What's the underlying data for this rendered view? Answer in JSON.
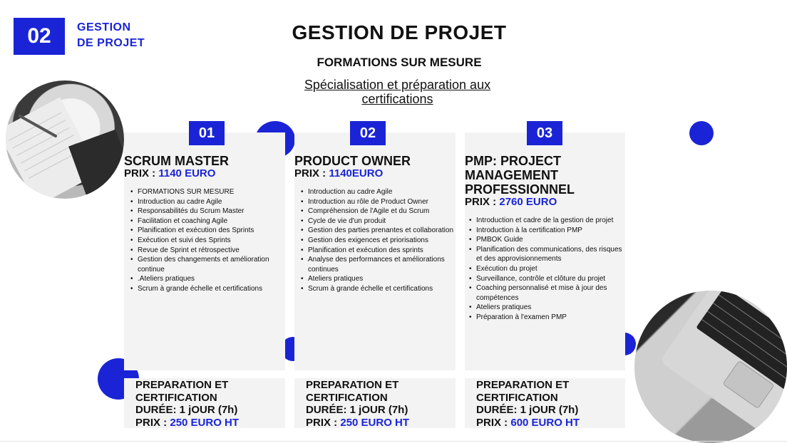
{
  "header": {
    "badge": "02",
    "section_line1": "GESTION",
    "section_line2": "DE PROJET",
    "title": "GESTION DE PROJET",
    "subtitle": "FORMATIONS SUR MESURE",
    "specialisation": "Spécialisation et préparation aux certifications"
  },
  "colors": {
    "accent": "#1a24d6",
    "card_bg": "#f3f3f3"
  },
  "cards": [
    {
      "number": "01",
      "title": "SCRUM MASTER",
      "price_label": "PRIX :",
      "price": "1140 EURO",
      "topics": [
        "FORMATIONS SUR MESURE",
        "Introduction au cadre Agile",
        "Responsabilités du Scrum Master",
        "Facilitation et coaching Agile",
        "Planification et exécution des Sprints",
        "Exécution et suivi des Sprints",
        "Revue de Sprint et rétrospective",
        "Gestion des changements et amélioration continue",
        ".Ateliers pratiques",
        "Scrum à grande échelle et certifications"
      ],
      "prep_title": "PREPARATION ET CERTIFICATION",
      "prep_duration": "DURÉE: 1 jOUR (7h)",
      "prep_price_label": "PRIX :",
      "prep_price": "250 EURO HT"
    },
    {
      "number": "02",
      "title": "PRODUCT OWNER",
      "price_label": "PRIX :",
      "price": "1140EURO",
      "topics": [
        "Introduction au cadre Agile",
        "Introduction au rôle de Product Owner",
        "Compréhension de l'Agile et du Scrum",
        "Cycle de vie d'un produit",
        "Gestion des parties prenantes et collaboration",
        "Gestion des exigences et priorisations",
        "Planification et exécution des sprints",
        "Analyse des performances et améliorations continues",
        "Ateliers pratiques",
        "Scrum à grande échelle et certifications"
      ],
      "prep_title": "PREPARATION ET CERTIFICATION",
      "prep_duration": "DURÉE: 1 jOUR (7h)",
      "prep_price_label": "PRIX :",
      "prep_price": "250 EURO HT"
    },
    {
      "number": "03",
      "title": "PMP: PROJECT MANAGEMENT PROFESSIONNEL",
      "price_label": "PRIX :",
      "price": "2760 EURO",
      "topics": [
        "Introduction et cadre de la gestion de projet",
        "Introduction à la certification PMP",
        "PMBOK Guide",
        "Planification des communications, des risques et des approvisionnements",
        "Exécution du projet",
        "Surveillance, contrôle et clôture du projet",
        "Coaching personnalisé et mise à jour des compétences",
        "Ateliers pratiques",
        "Préparation à l'examen PMP"
      ],
      "prep_title": "PREPARATION ET CERTIFICATION",
      "prep_duration": "DURÉE: 1 jOUR (7h)",
      "prep_price_label": "PRIX :",
      "prep_price": "600 EURO HT"
    }
  ]
}
